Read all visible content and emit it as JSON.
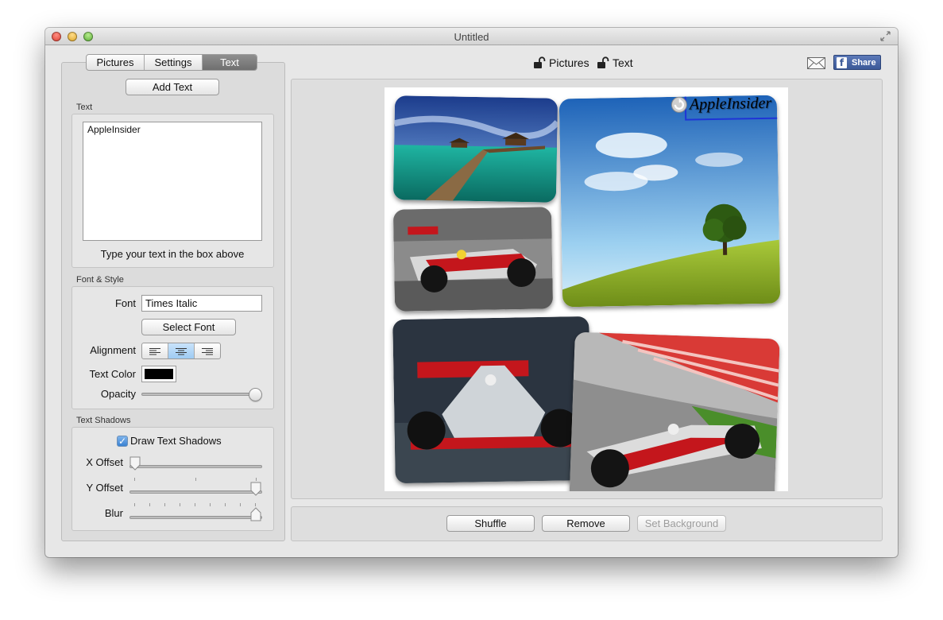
{
  "window": {
    "title": "Untitled"
  },
  "tabs": [
    "Pictures",
    "Settings",
    "Text"
  ],
  "active_tab": "Text",
  "sidebar": {
    "add_text_label": "Add Text",
    "text_group_label": "Text",
    "text_value": "AppleInsider",
    "text_hint": "Type your text in the box above",
    "font_group_label": "Font & Style",
    "font_label": "Font",
    "font_value": "Times Italic",
    "select_font_label": "Select Font",
    "alignment_label": "Alignment",
    "alignment_options": [
      "left",
      "center",
      "right"
    ],
    "alignment_selected": "center",
    "text_color_label": "Text Color",
    "text_color_value": "#000000",
    "opacity_label": "Opacity",
    "opacity_value": 1.0,
    "shadows_group_label": "Text Shadows",
    "draw_shadows_label": "Draw Text Shadows",
    "draw_shadows_checked": true,
    "x_offset_label": "X Offset",
    "x_offset_value": 0.0,
    "y_offset_label": "Y Offset",
    "y_offset_value": 1.0,
    "blur_label": "Blur",
    "blur_value": 1.0
  },
  "toolbar": {
    "pictures_label": "Pictures",
    "text_label": "Text",
    "lock_icon": "unlock-icon",
    "mail_icon": "mail-icon",
    "share_label": "Share",
    "facebook_icon": "facebook-icon"
  },
  "collage": {
    "overlay_text": "AppleInsider",
    "overlay_icon": "rotate-icon"
  },
  "bottom": {
    "shuffle_label": "Shuffle",
    "remove_label": "Remove",
    "set_background_label": "Set Background"
  },
  "colors": {
    "active_tab": "#7f7f7f",
    "selection_border": "#1f34d6",
    "facebook_blue": "#3b5998"
  }
}
